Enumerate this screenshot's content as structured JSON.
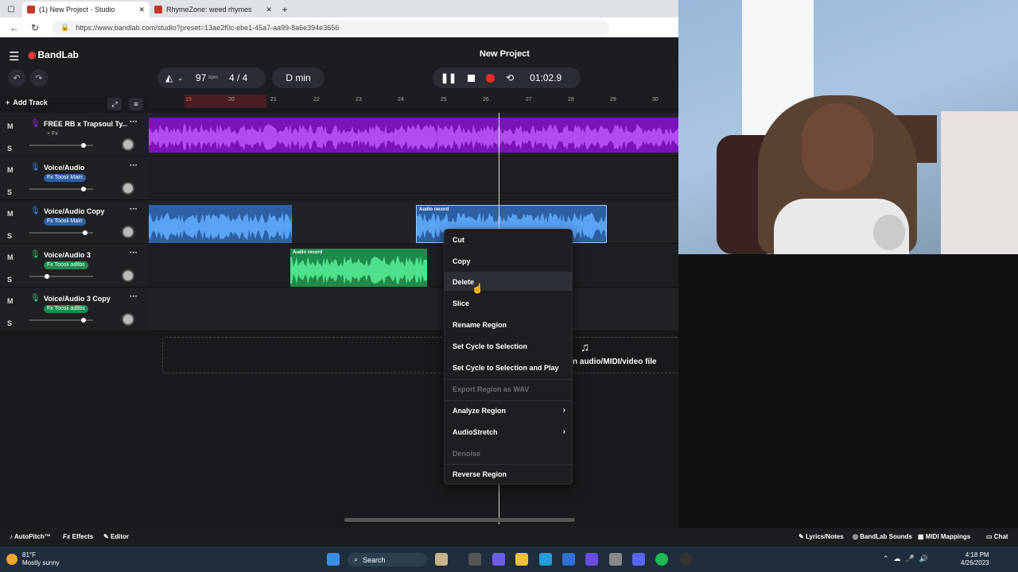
{
  "browser": {
    "tabs": [
      {
        "label": "(1) New Project - Studio",
        "active": true
      },
      {
        "label": "RhymeZone: weed rhymes",
        "active": false
      }
    ],
    "new_tab": "+",
    "close": "✕",
    "url": "https://www.bandlab.com/studio?preset=13ae2f0c-ebe1-45a7-aa99-8a6e394e3656"
  },
  "app": {
    "logo": "BandLab",
    "project_title": "New Project",
    "tempo": "97",
    "bpm_label": "bpm",
    "time_signature": "4 / 4",
    "key": "D min",
    "time": "01:02.9",
    "add_track": "Add Track"
  },
  "ruler": [
    "19",
    "20",
    "21",
    "22",
    "23",
    "24",
    "25",
    "26",
    "27",
    "28",
    "29",
    "30"
  ],
  "tracks": [
    {
      "name": "FREE RB x Trapsoul Ty...",
      "fx": "+ Fx",
      "color": "#9b22e6",
      "mute": "M",
      "solo": "S",
      "volume": 0.85
    },
    {
      "name": "Voice/Audio",
      "fx": "Fx Toosii Main",
      "color": "#3d86e0",
      "mute": "M",
      "solo": "S",
      "volume": 0.85
    },
    {
      "name": "Voice/Audio Copy",
      "fx": "Fx Toosii Main",
      "color": "#3d86e0",
      "mute": "M",
      "solo": "S",
      "volume": 0.88
    },
    {
      "name": "Voice/Audio 3",
      "fx": "Fx Toosii adlibs",
      "color": "#2ecc71",
      "mute": "M",
      "solo": "S",
      "volume": 0.28
    },
    {
      "name": "Voice/Audio 3 Copy",
      "fx": "Fx Toosii adlibs",
      "color": "#2ecc71",
      "mute": "M",
      "solo": "S",
      "volume": 0.85
    }
  ],
  "regions": {
    "audio_record_label": "Audio record"
  },
  "drop_text": "n audio/MIDI/video file",
  "context_menu": [
    {
      "label": "Cut",
      "disabled": false
    },
    {
      "label": "Copy",
      "disabled": false
    },
    {
      "label": "Delete",
      "disabled": false,
      "highlighted": true
    },
    {
      "label": "Slice",
      "disabled": false
    },
    {
      "label": "Rename Region",
      "disabled": false
    },
    {
      "label": "Set Cycle to Selection",
      "disabled": false
    },
    {
      "label": "Set Cycle to Selection and Play",
      "disabled": false
    },
    {
      "label": "Export Region as WAV",
      "disabled": true
    },
    {
      "label": "Analyze Region",
      "disabled": false,
      "submenu": true
    },
    {
      "label": "AudioStretch",
      "disabled": false,
      "submenu": true
    },
    {
      "label": "Denoise",
      "disabled": true
    },
    {
      "label": "Reverse Region",
      "disabled": false
    }
  ],
  "bottom_bar": {
    "autopitch": "AutoPitch™",
    "effects": "Effects",
    "editor": "Editor",
    "lyrics": "Lyrics/Notes",
    "sounds": "BandLab Sounds",
    "midi": "MIDI Mappings",
    "chat": "Chat"
  },
  "taskbar": {
    "temp": "81°F",
    "weather": "Mostly sunny",
    "search": "Search",
    "time": "4:18 PM",
    "date": "4/26/2023"
  },
  "colors": {
    "accent": "#f03e3e",
    "purple": "#9b22e6",
    "blue": "#3d86e0",
    "green": "#2ecc71"
  }
}
